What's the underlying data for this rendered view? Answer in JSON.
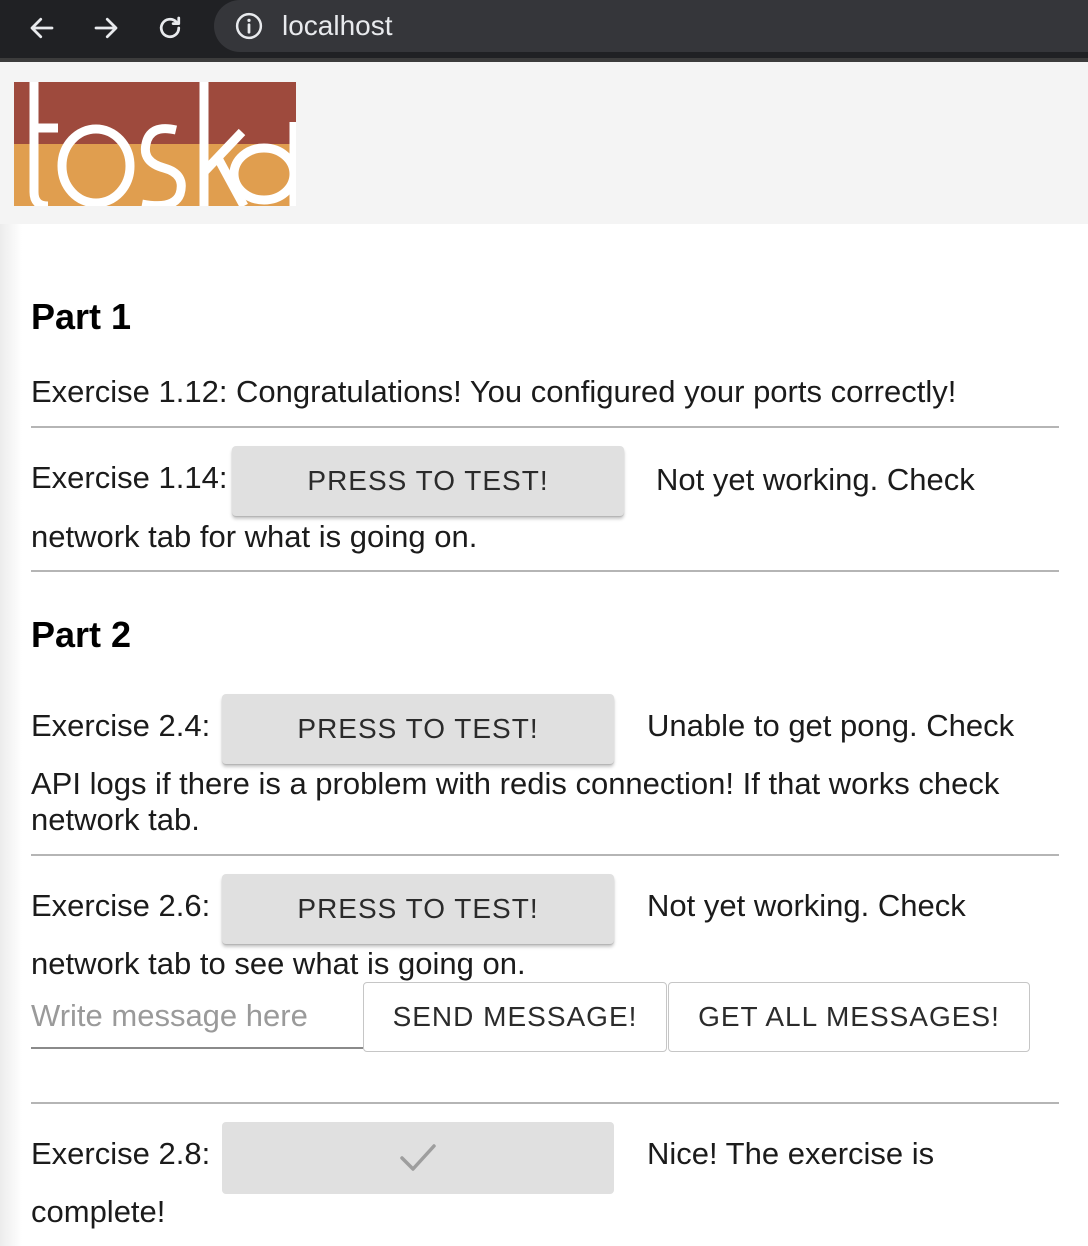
{
  "browser": {
    "url": "localhost"
  },
  "logo_text": "toska",
  "part1": {
    "title": "Part 1",
    "ex112": "Exercise 1.12: Congratulations! You configured your ports correctly!",
    "ex114_label": "Exercise 1.14:",
    "ex114_button": "PRESS TO TEST!",
    "ex114_status_a": "Not yet working. Check",
    "ex114_status_b": "network tab for what is going on."
  },
  "part2": {
    "title": "Part 2",
    "ex24_label": "Exercise 2.4:",
    "ex24_button": "PRESS TO TEST!",
    "ex24_status_a": "Unable to get pong. Check",
    "ex24_status_b": "API logs if there is a problem with redis connection! If that works check network tab.",
    "ex26_label": "Exercise 2.6:",
    "ex26_button": "PRESS TO TEST!",
    "ex26_status_a": "Not yet working. Check",
    "ex26_status_b": "network tab to see what is going on.",
    "message_placeholder": "Write message here",
    "send_button": "SEND MESSAGE!",
    "get_all_button": "GET ALL MESSAGES!",
    "ex28_label": "Exercise 2.8:",
    "ex28_status_a": "Nice! The exercise is",
    "ex28_status_b": "complete!"
  },
  "colors": {
    "logo_red": "#9e4a3d",
    "logo_orange": "#e09e4f"
  },
  "icons": [
    "back-arrow-icon",
    "forward-arrow-icon",
    "reload-icon",
    "info-icon",
    "check-icon"
  ]
}
